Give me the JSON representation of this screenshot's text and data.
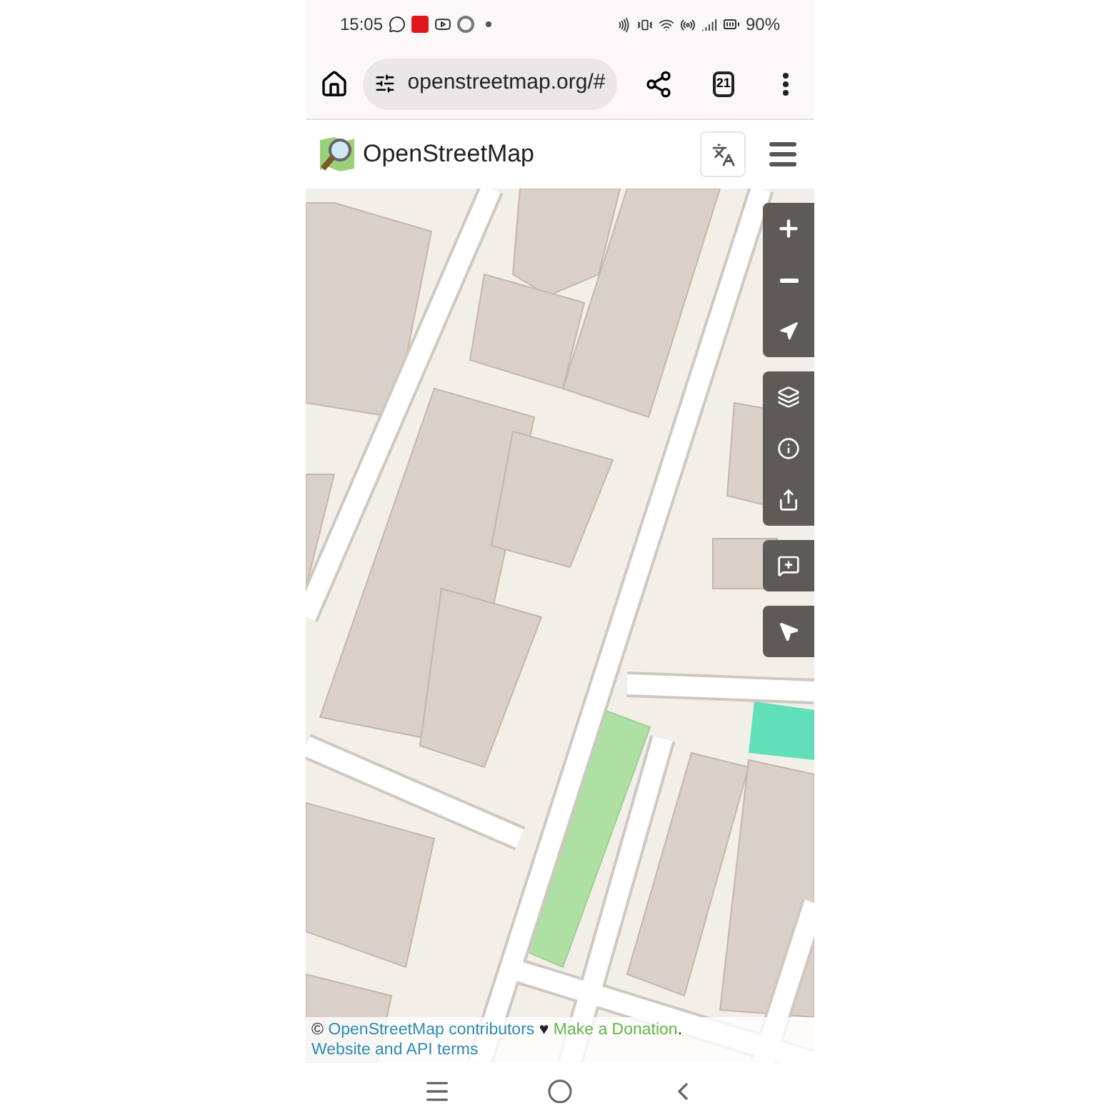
{
  "status_bar": {
    "time": "15:05",
    "battery": "90%"
  },
  "browser": {
    "url": "openstreetmap.org/#",
    "tab_count": "21"
  },
  "header": {
    "title": "OpenStreetMap"
  },
  "attribution": {
    "prefix": "©",
    "contributors_link": "OpenStreetMap contributors",
    "heart": "♥",
    "donation_link": "Make a Donation",
    "separator": ".",
    "terms_link": "Website and API terms"
  }
}
